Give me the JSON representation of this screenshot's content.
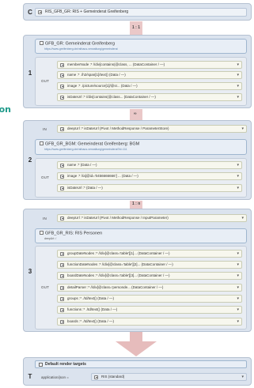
{
  "fragment_text": "on",
  "stage_c": {
    "num": "C",
    "label": "RIS_GFB_GR: RIS + Gemeinderat Greifenberg"
  },
  "conn_c_1": {
    "label": "1 : 1"
  },
  "stage_1": {
    "num": "1",
    "source_title": "GFB_GR: Gemeinderat Greifenberg",
    "source_url": "https://www.greifenberg.de/rathaus-verwaltung/gemeinderat",
    "out_label": "OUT",
    "outputs": [
      "memberNode :* //div[contains(@class, ...  (DataContainer / —)",
      "name :* ./h2/span[1]/text() (Data / —)",
      "image :* ./picture/source[1]/@sr... (Data / —)",
      "isDateUrl :* //div[contains(@class... (DataContainer / —)"
    ]
  },
  "conn_1_2": {
    "label": "∞"
  },
  "stage_2": {
    "num": "2",
    "in_label": "IN",
    "in_value": "deepUrl :* isDateUrl (Pivot / MethodResponse / ParameterStore)",
    "source_title": "GFB_GR_BGM: Gemeinderat Greifenberg: BGM",
    "source_url": "https://www.greifenberg.de/rathaus-verwaltung/gemeinderat?id=111",
    "out_label": "OUT",
    "outputs": [
      "name :* (Data / —)",
      "image :* //a[@id='0456666666'] ... (Data / —)",
      "isDateUrl :* (Data / —)"
    ]
  },
  "conn_2_3": {
    "label": "1 : n"
  },
  "stage_3": {
    "num": "3",
    "in_label": "IN",
    "in_value": "deepUrl :* isDateUrl (Pivot / MethodResponse / InputParameter)",
    "source_title": "GFB_GR_RIS: RIS Personen",
    "source_sub": "deepUrl: /",
    "out_label": "OUT",
    "outputs": [
      "groupDateNodes :* //div[@class='table'][1]... (DataContainer / —)",
      "functionDateNodes :* //div[@class='table'][2]... (DataContainer / —)",
      "boardDateNodes :* //div[@class='table'][3]... (DataContainer / —)",
      "detailParser :* //div[@class='personde... (DataContainer / —)",
      "groups :* ./td/text() (Data / —)",
      "functions :* ./td/text() (Data / —)",
      "boards :* ./td/text() (Data / —)"
    ]
  },
  "stage_t": {
    "num": "T",
    "title": "Default render targets",
    "row_label": "application/json =",
    "row_value": "RIS (standard)"
  },
  "colors": {
    "stage_bg": "#dbe3ee",
    "pill_bg": "#f7f7ee",
    "connector": "#eac8c8",
    "fragment_text": "#1e9a8a"
  }
}
